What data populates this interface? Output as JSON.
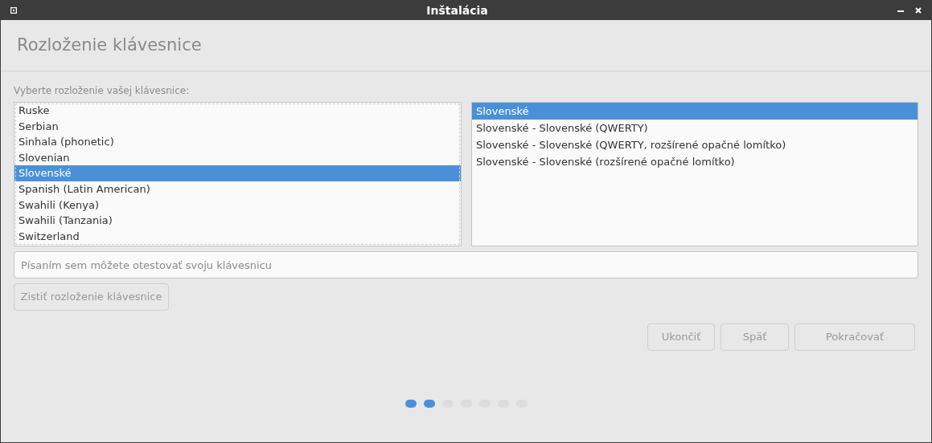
{
  "window": {
    "title": "Inštalácia"
  },
  "header": {
    "title": "Rozloženie klávesnice"
  },
  "prompt": "Vyberte rozloženie vašej klávesnice:",
  "layouts": [
    {
      "label": "Ruske",
      "selected": false
    },
    {
      "label": "Serbian",
      "selected": false
    },
    {
      "label": "Sinhala (phonetic)",
      "selected": false
    },
    {
      "label": "Slovenian",
      "selected": false
    },
    {
      "label": "Slovenské",
      "selected": true
    },
    {
      "label": "Spanish (Latin American)",
      "selected": false
    },
    {
      "label": "Swahili (Kenya)",
      "selected": false
    },
    {
      "label": "Swahili (Tanzania)",
      "selected": false
    },
    {
      "label": "Switzerland",
      "selected": false
    }
  ],
  "variants": [
    {
      "label": "Slovenské",
      "selected": true
    },
    {
      "label": "Slovenské - Slovenské (QWERTY)",
      "selected": false
    },
    {
      "label": "Slovenské - Slovenské (QWERTY, rozšírené opačné lomítko)",
      "selected": false
    },
    {
      "label": "Slovenské - Slovenské (rozšírené opačné lomítko)",
      "selected": false
    }
  ],
  "test_field": {
    "placeholder": "Písaním sem môžete otestovať svoju klávesnicu"
  },
  "detect_button": {
    "label": "Zistiť rozloženie klávesnice",
    "disabled": true
  },
  "nav_buttons": [
    {
      "label": "Ukončiť",
      "disabled": true
    },
    {
      "label": "Späť",
      "disabled": true
    },
    {
      "label": "Pokračovať",
      "disabled": true
    }
  ],
  "steps": [
    {
      "done": true
    },
    {
      "done": true
    },
    {
      "done": false
    },
    {
      "done": false
    },
    {
      "done": false
    },
    {
      "done": false
    },
    {
      "done": false
    }
  ]
}
